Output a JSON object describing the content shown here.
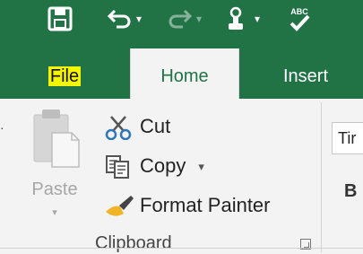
{
  "colors": {
    "accent": "#217346",
    "file_highlight": "#f3f600"
  },
  "quick_access": {
    "items": [
      "save-icon",
      "undo-icon",
      "redo-icon",
      "touch-mode-icon",
      "spelling-icon"
    ],
    "spelling_badge": "ABC"
  },
  "tabs": [
    {
      "label": "File"
    },
    {
      "label": "Home"
    },
    {
      "label": "Insert"
    }
  ],
  "clipboard": {
    "paste_label": "Paste",
    "cut_label": "Cut",
    "copy_label": "Copy",
    "format_painter_label": "Format Painter",
    "group_label": "Clipboard"
  },
  "font": {
    "font_name_value": "Tir",
    "bold_label": "B"
  }
}
